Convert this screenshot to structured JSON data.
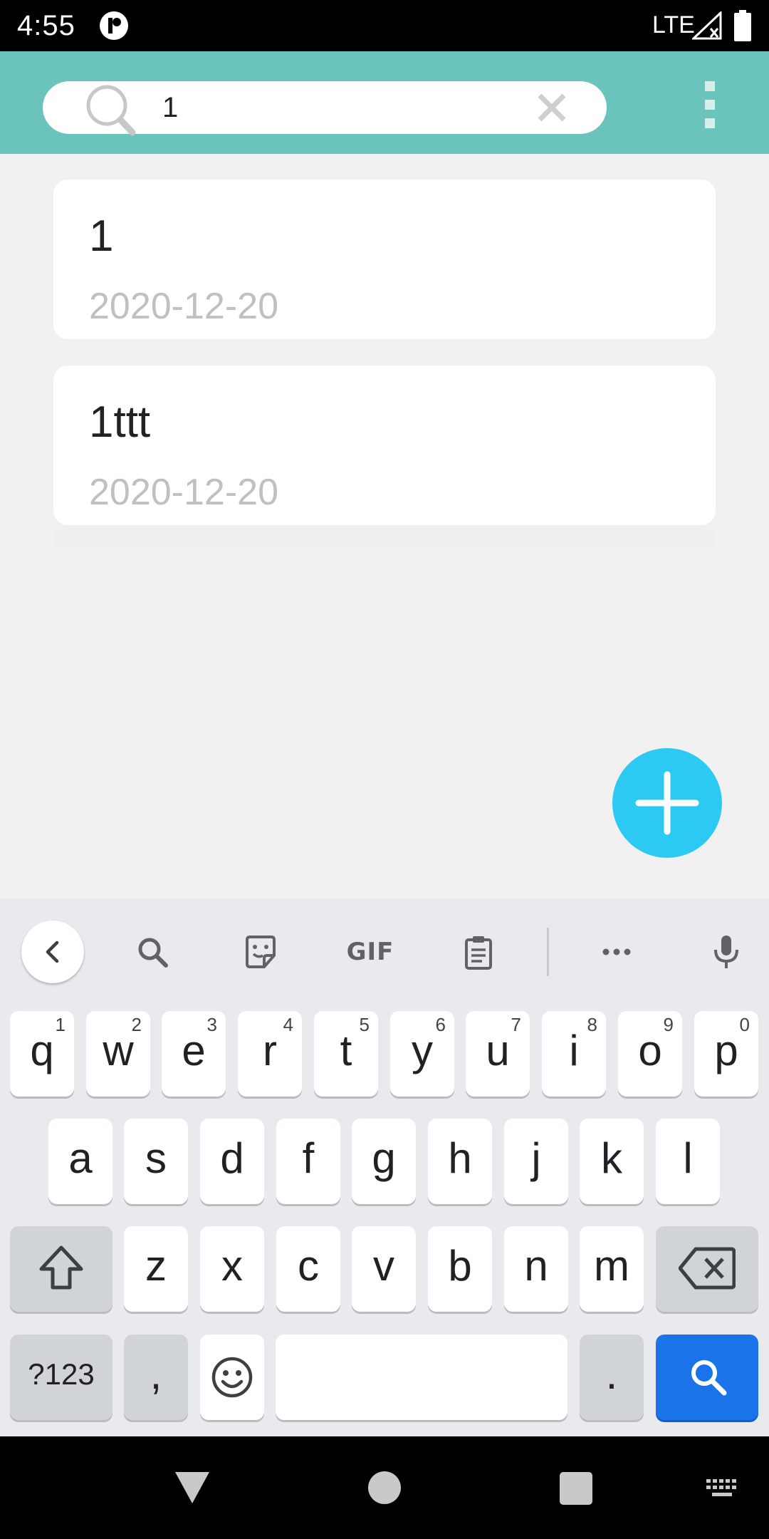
{
  "status_bar": {
    "time": "4:55",
    "network": "LTE"
  },
  "search": {
    "query": "1"
  },
  "notes": [
    {
      "title": "1",
      "date": "2020-12-20"
    },
    {
      "title": "1ttt",
      "date": "2020-12-20"
    }
  ],
  "colors": {
    "app_bar": "#6ac3bd",
    "fab": "#2ccaf2",
    "keyboard_action": "#1a73e8"
  },
  "keyboard": {
    "toolbar": {
      "gif_label": "GIF"
    },
    "row1": [
      {
        "key": "q",
        "hint": "1"
      },
      {
        "key": "w",
        "hint": "2"
      },
      {
        "key": "e",
        "hint": "3"
      },
      {
        "key": "r",
        "hint": "4"
      },
      {
        "key": "t",
        "hint": "5"
      },
      {
        "key": "y",
        "hint": "6"
      },
      {
        "key": "u",
        "hint": "7"
      },
      {
        "key": "i",
        "hint": "8"
      },
      {
        "key": "o",
        "hint": "9"
      },
      {
        "key": "p",
        "hint": "0"
      }
    ],
    "row2": [
      "a",
      "s",
      "d",
      "f",
      "g",
      "h",
      "j",
      "k",
      "l"
    ],
    "row3": [
      "z",
      "x",
      "c",
      "v",
      "b",
      "n",
      "m"
    ],
    "row4": {
      "symbols": "?123",
      "comma": ",",
      "period": "."
    }
  }
}
